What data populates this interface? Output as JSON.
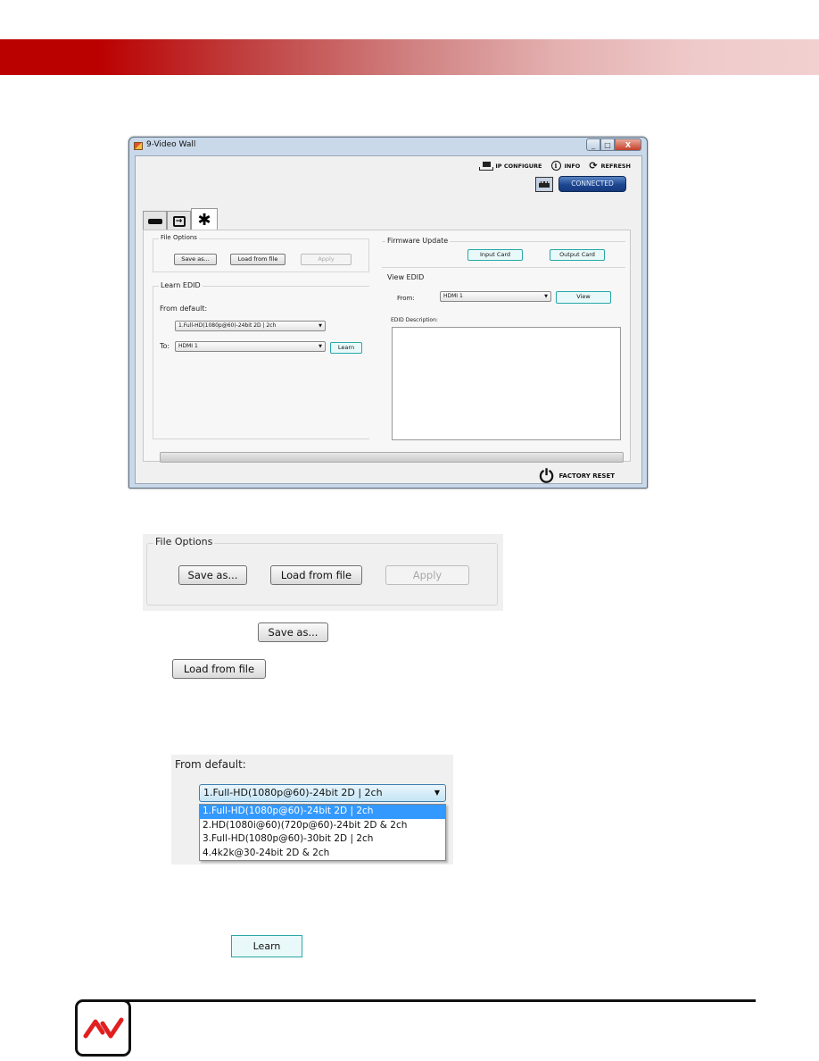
{
  "window": {
    "title": "9-Video Wall",
    "controls": {
      "minimize": "_",
      "maximize": "□",
      "close": "X"
    }
  },
  "toolbar": {
    "ip_configure": "IP CONFIGURE",
    "info": "INFO",
    "refresh": "REFRESH",
    "connected": "CONNECTED",
    "icons": {
      "ip": "network-icon",
      "info": "ⓘ",
      "refresh": "⟳"
    }
  },
  "tabs": [
    {
      "name": "output",
      "icon": "output-icon"
    },
    {
      "name": "input",
      "icon": "input-icon"
    },
    {
      "name": "settings",
      "icon": "✱",
      "active": true
    }
  ],
  "file_options": {
    "legend": "File Options",
    "save_as": "Save as...",
    "load_from_file": "Load from file",
    "apply": "Apply"
  },
  "learn_edid": {
    "legend": "Learn EDID",
    "from_default_label": "From default:",
    "from_default_value": "1.Full-HD(1080p@60)-24bit 2D | 2ch",
    "to_label": "To:",
    "to_value": "HDMI 1",
    "learn": "Learn"
  },
  "firmware_update": {
    "legend": "Firmware Update",
    "input_card": "Input Card",
    "output_card": "Output Card"
  },
  "view_edid": {
    "legend": "View EDID",
    "from_label": "From:",
    "from_value": "HDMI 1",
    "view": "View",
    "description_label": "EDID Description:",
    "description": ""
  },
  "progress": {
    "value_percent": 0
  },
  "factory_reset": "FACTORY RESET",
  "callouts": {
    "file_options": {
      "legend": "File Options",
      "save_as": "Save as...",
      "load_from_file": "Load from file",
      "apply": "Apply"
    },
    "save_as_button": "Save as...",
    "load_from_file_button": "Load from file",
    "from_default": {
      "label": "From default:",
      "selected": "1.Full-HD(1080p@60)-24bit 2D | 2ch",
      "options": [
        "1.Full-HD(1080p@60)-24bit 2D | 2ch",
        "2.HD(1080i@60)(720p@60)-24bit 2D & 2ch",
        "3.Full-HD(1080p@60)-30bit 2D | 2ch",
        "4.4k2k@30-24bit 2D & 2ch"
      ]
    },
    "learn_button": "Learn"
  },
  "colors": {
    "header_red": "#bb0000",
    "connected_blue": "#1d4691",
    "teal_border": "#2aa7a7",
    "selection_blue": "#3399ff",
    "logo_red": "#e02020"
  }
}
